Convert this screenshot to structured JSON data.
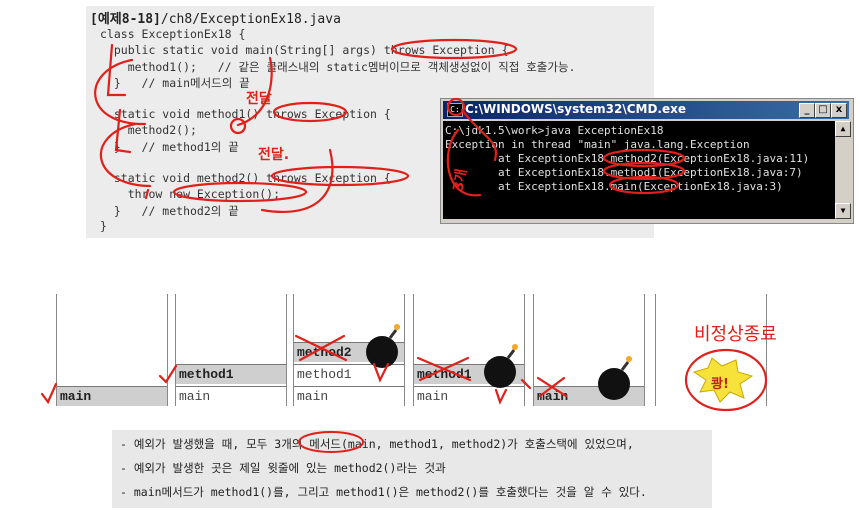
{
  "code": {
    "title_prefix": "[예제8-18]",
    "title_path": "/ch8/ExceptionEx18.java",
    "lines": [
      "class ExceptionEx18 {",
      "  public static void main(String[] args) throws Exception {",
      "    method1();   // 같은 클래스내의 static멤버이므로 객체생성없이 직접 호출가능.",
      "  }   // main메서드의 끝",
      "",
      "  static void method1() throws Exception {",
      "    method2();",
      "  }   // method1의 끝",
      "",
      "  static void method2() throws Exception {",
      "    throw new Exception();",
      "  }   // method2의 끝",
      "}"
    ]
  },
  "annotations": {
    "pass1": "전달",
    "pass2": "전달.",
    "count3": "3개",
    "abnormal_exit": "비정상종료",
    "bang": "쾅!"
  },
  "cmd": {
    "title": "C:\\WINDOWS\\system32\\CMD.exe",
    "lines": [
      "C:\\jdk1.5\\work>java ExceptionEx18",
      "Exception in thread \"main\" java.lang.Exception",
      "        at ExceptionEx18.method2(ExceptionEx18.java:11)",
      "        at ExceptionEx18.method1(ExceptionEx18.java:7)",
      "        at ExceptionEx18.main(ExceptionEx18.java:3)"
    ],
    "btn_min": "_",
    "btn_max": "□",
    "btn_close": "x"
  },
  "stacks": [
    {
      "frames": [
        "main"
      ]
    },
    {
      "frames": [
        "method1",
        "main"
      ]
    },
    {
      "frames": [
        "method2",
        "method1",
        "main"
      ]
    },
    {
      "frames": [
        "method1",
        "main"
      ]
    },
    {
      "frames": [
        "main"
      ]
    },
    {
      "frames": []
    }
  ],
  "notes": [
    "- 예외가 발생했을 때, 모두 3개의 메서드(main, method1, method2)가 호출스택에 있었으며,",
    "- 예외가 발생한 곳은 제일 윗줄에 있는 method2()라는 것과",
    "- main메서드가 method1()를, 그리고 method1()은 method2()를 호출했다는 것을 알 수 있다."
  ]
}
